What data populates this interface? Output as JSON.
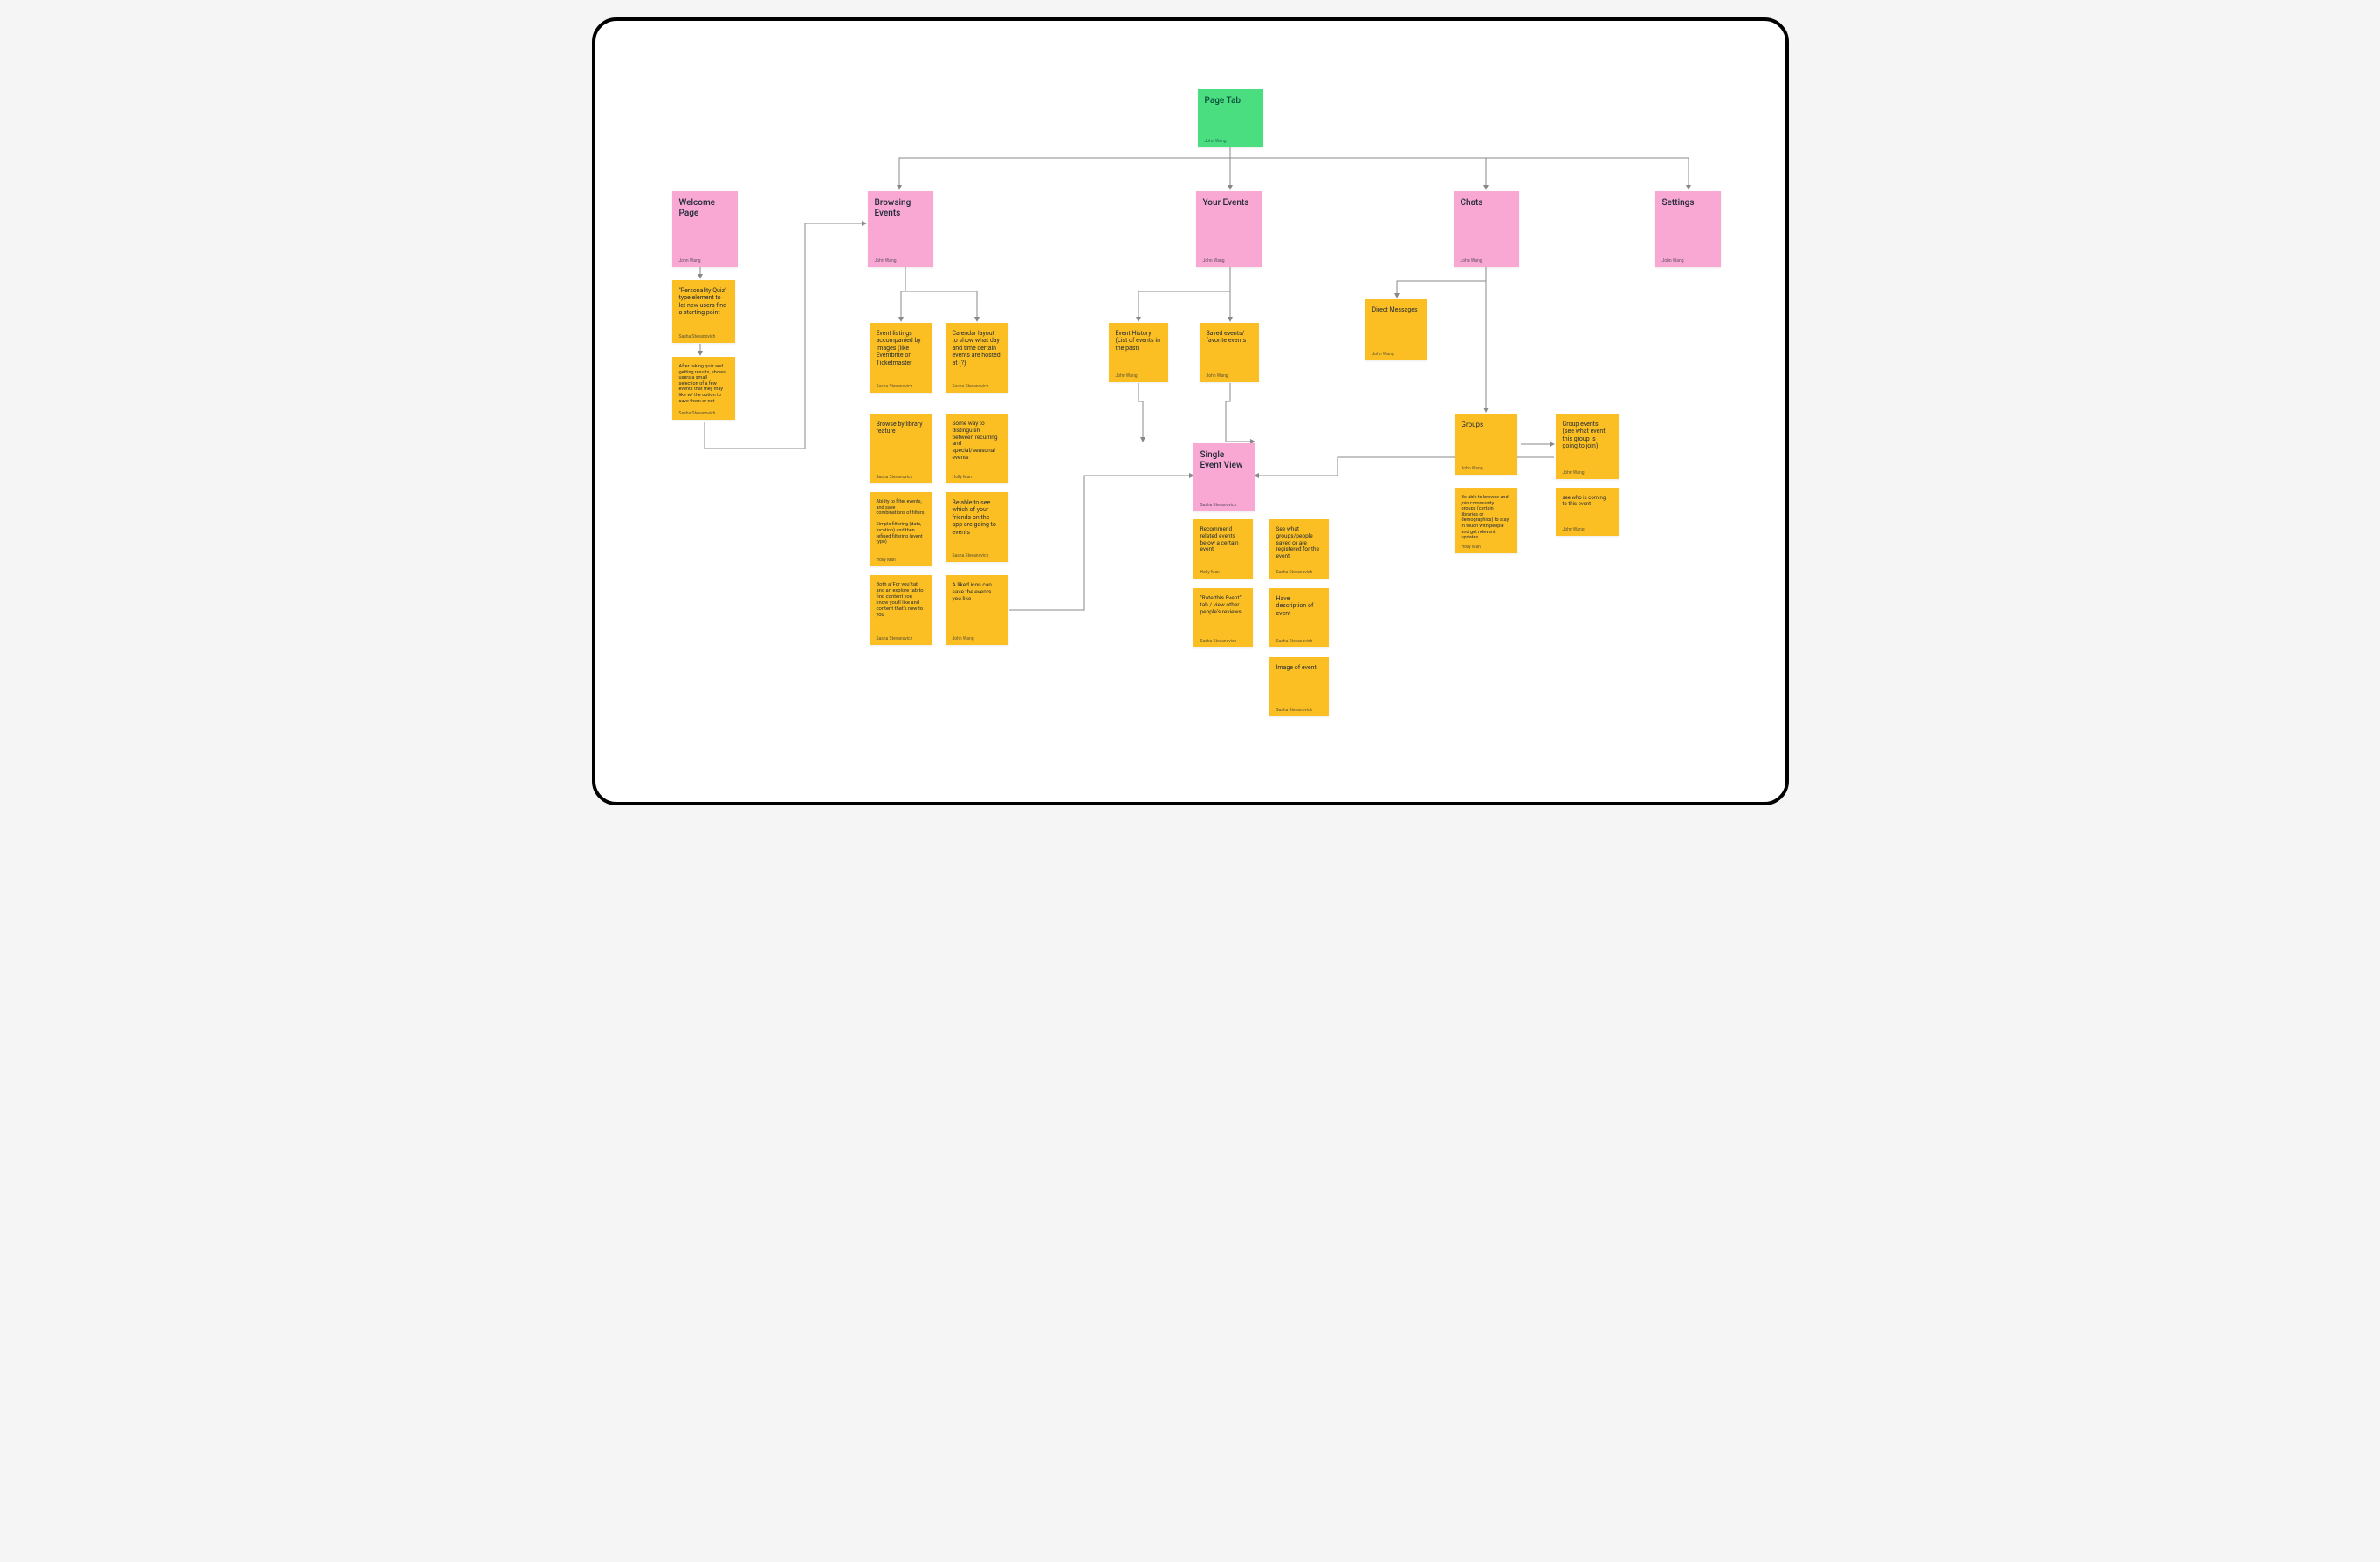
{
  "root": {
    "title": "Page Tab",
    "author": "John Wang"
  },
  "welcome": {
    "title": "Welcome Page",
    "author": "John Wang",
    "quiz": {
      "text": "\"Personality Quiz\" type element to let new users find a starting point",
      "author": "Sasha Stevanovich"
    },
    "results": {
      "text": "After taking quiz and getting results, shows users a small selection of a few events that they may like w/ the option to save them or not",
      "author": "Sasha Stevanovich"
    }
  },
  "browsing": {
    "title": "Browsing Events",
    "author": "John Wang",
    "listings": {
      "text": "Event listings accompanied by images (like Eventbrite or Ticketmaster",
      "author": "Sasha Stevanovich"
    },
    "calendar": {
      "text": "Calendar layout to show what day and time certain events are hosted at (?)",
      "author": "Sasha Stevanovich"
    },
    "byLibrary": {
      "text": "Browse by library feature",
      "author": "Sasha Stevanovich"
    },
    "recurring": {
      "text": "Some way to distinguish between recurring and special/seasonal events",
      "author": "Holly Man"
    },
    "filter": {
      "text": "Ability to filter events, and save combinations of filters\n\nSimple filtering (date, location) and then refined filtering (event type)",
      "author": "Holly Man"
    },
    "friends": {
      "text": "Be able to see which of your friends on the app are going to events",
      "author": "Sasha Stevanovich"
    },
    "forYou": {
      "text": "Both a 'For you' tab and an explore tab to find content you know you'll like and content that's new to you",
      "author": "Sasha Stevanovich"
    },
    "liked": {
      "text": "A liked icon can save the events you like",
      "author": "John Wang"
    }
  },
  "yourEvents": {
    "title": "Your Events",
    "author": "John Wang",
    "history": {
      "text": "Event History (List of events in the past)",
      "author": "John Wang"
    },
    "saved": {
      "text": "Saved events/ favorite events",
      "author": "John Wang"
    }
  },
  "singleEvent": {
    "title": "Single Event View",
    "author": "Sasha Stevanovich",
    "recommend": {
      "text": "Recommend related events below a certain event",
      "author": "Holly Man"
    },
    "whoSaved": {
      "text": "See what groups/people saved or are registered for the event",
      "author": "Sasha Stevanovich"
    },
    "rate": {
      "text": "\"Rate this Event\" tab / view other people's reviews",
      "author": "Sasha Stevanovich"
    },
    "description": {
      "text": "Have description of event",
      "author": "Sasha Stevanovich"
    },
    "image": {
      "text": "Image of event",
      "author": "Sasha Stevanovich"
    }
  },
  "chats": {
    "title": "Chats",
    "author": "John Wang",
    "dm": {
      "text": "Direct Messages",
      "author": "John Wang"
    },
    "groups": {
      "text": "Groups",
      "author": "John Wang"
    },
    "browseGroups": {
      "text": "Be able to browse and join community groups (certain libraries or demographics) to stay in touch with people and get relevant updates",
      "author": "Holly Man"
    },
    "groupEvents": {
      "text": "Group events (see what event this group is going to join)",
      "author": "John Wang"
    },
    "whoComing": {
      "text": "see who is coming to this event",
      "author": "John Wang"
    }
  },
  "settings": {
    "title": "Settings",
    "author": "John Wang"
  }
}
